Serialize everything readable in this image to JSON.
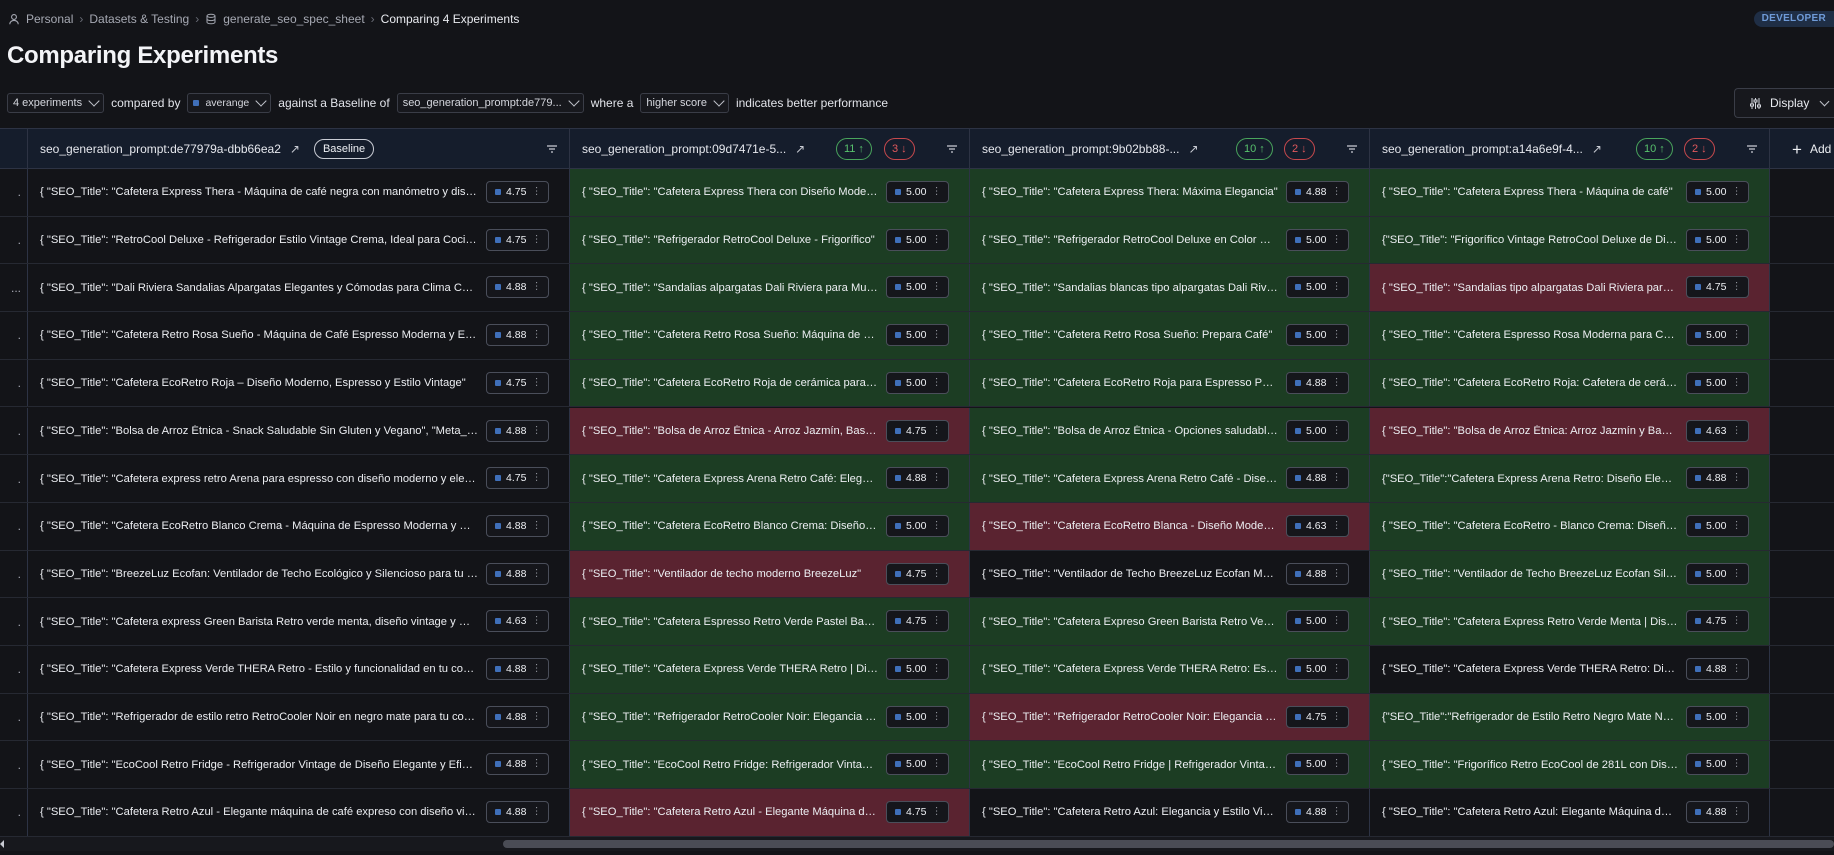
{
  "breadcrumb": {
    "items": [
      "Personal",
      "Datasets & Testing",
      "generate_seo_spec_sheet",
      "Comparing 4 Experiments"
    ]
  },
  "badge": "DEVELOPER",
  "title": "Comparing Experiments",
  "filters": {
    "experiments": "4 experiments",
    "compared_by_label": "compared by",
    "metric": "averange",
    "baseline_label": "against a Baseline of",
    "baseline": "seo_generation_prompt:de779...",
    "where_label": "where a",
    "direction": "higher score",
    "indicates_label": "indicates better performance"
  },
  "display_button": "Display",
  "columns": [
    {
      "name": "seo_generation_prompt:de77979a-dbb66ea2",
      "baseline": "Baseline"
    },
    {
      "name": "seo_generation_prompt:09d7471e-5...",
      "up": "11",
      "down": "3"
    },
    {
      "name": "seo_generation_prompt:9b02bb88-...",
      "up": "10",
      "down": "2"
    },
    {
      "name": "seo_generation_prompt:a14a6e9f-4...",
      "up": "10",
      "down": "2"
    }
  ],
  "add_column": "Add",
  "colors": {
    "better": "#1c3d23",
    "worse": "#5a2330",
    "accent": "#3f6fb9"
  },
  "rows": [
    {
      "stub": ".",
      "cells": [
        {
          "text": "{ \"SEO_Title\": \"Cafetera Express Thera - Máquina de café negra con manómetro y diseño retro\"",
          "score": "4.75",
          "status": ""
        },
        {
          "text": "{ \"SEO_Title\": \"Cafetera Express Thera con Diseño Moderno\"",
          "score": "5.00",
          "status": "g"
        },
        {
          "text": "{ \"SEO_Title\": \"Cafetera Express Thera: Máxima Elegancia\"",
          "score": "4.88",
          "status": "g"
        },
        {
          "text": "{ \"SEO_Title\": \"Cafetera Express Thera - Máquina de café\"",
          "score": "5.00",
          "status": "g"
        }
      ]
    },
    {
      "stub": ".",
      "cells": [
        {
          "text": "{ \"SEO_Title\": \"RetroCool Deluxe - Refrigerador Estilo Vintage Crema, Ideal para Cocinas\"",
          "score": "4.75",
          "status": ""
        },
        {
          "text": "{ \"SEO_Title\": \"Refrigerador RetroCool Deluxe - Frigorífico\"",
          "score": "5.00",
          "status": "g"
        },
        {
          "text": "{ \"SEO_Title\": \"Refrigerador RetroCool Deluxe en Color Crema\"",
          "score": "5.00",
          "status": "g"
        },
        {
          "text": "{\"SEO_Title\": \"Frigorífico Vintage RetroCool Deluxe de Diseño\"",
          "score": "5.00",
          "status": "g"
        }
      ]
    },
    {
      "stub": "...",
      "cells": [
        {
          "text": "{ \"SEO_Title\": \"Dali Riviera Sandalias Alpargatas Elegantes y Cómodas para Clima Cálido\"",
          "score": "4.88",
          "status": ""
        },
        {
          "text": "{ \"SEO_Title\": \"Sandalias alpargatas Dali Riviera para Mujer\"",
          "score": "5.00",
          "status": "g"
        },
        {
          "text": "{ \"SEO_Title\": \"Sandalias blancas tipo alpargatas Dali Riviera\"",
          "score": "5.00",
          "status": "g"
        },
        {
          "text": "{ \"SEO_Title\": \"Sandalias tipo alpargatas Dali Riviera para Mujer\"",
          "score": "4.75",
          "status": "r"
        }
      ]
    },
    {
      "stub": ".",
      "cells": [
        {
          "text": "{ \"SEO_Title\": \"Cafetera Retro Rosa Sueño - Máquina de Café Espresso Moderna y Elegante\"",
          "score": "4.88",
          "status": ""
        },
        {
          "text": "{ \"SEO_Title\": \"Cafetera Retro Rosa Sueño: Máquina de Café\"",
          "score": "5.00",
          "status": "g"
        },
        {
          "text": "{ \"SEO_Title\": \"Cafetera Retro Rosa Sueño: Prepara Café\"",
          "score": "5.00",
          "status": "g"
        },
        {
          "text": "{ \"SEO_Title\": \"Cafetera Espresso Rosa Moderna para Casa\"",
          "score": "5.00",
          "status": "g"
        }
      ]
    },
    {
      "stub": ".",
      "cells": [
        {
          "text": "{ \"SEO_Title\": \"Cafetera EcoRetro Roja – Diseño Moderno, Espresso y Estilo Vintage\"",
          "score": "4.75",
          "status": ""
        },
        {
          "text": "{ \"SEO_Title\": \"Cafetera EcoRetro Roja de cerámica para Espresso\"",
          "score": "5.00",
          "status": "g"
        },
        {
          "text": "{ \"SEO_Title\": \"Cafetera EcoRetro Roja para Espresso Perfecto\"",
          "score": "4.88",
          "status": "g"
        },
        {
          "text": "{ \"SEO_Title\": \"Cafetera EcoRetro Roja: Cafetera de cerámica\"",
          "score": "5.00",
          "status": "g"
        }
      ]
    },
    {
      "stub": ".",
      "cells": [
        {
          "text": "{ \"SEO_Title\": \"Bolsa de Arroz Étnica - Snack Saludable Sin Gluten y Vegano\", \"Meta_Description\"",
          "score": "4.88",
          "status": ""
        },
        {
          "text": "{ \"SEO_Title\": \"Bolsa de Arroz Étnica - Arroz Jazmín, Basmati\"",
          "score": "4.75",
          "status": "r"
        },
        {
          "text": "{ \"SEO_Title\": \"Bolsa de Arroz Étnica - Opciones saludables\"",
          "score": "5.00",
          "status": "g"
        },
        {
          "text": "{ \"SEO_Title\": \"Bolsa de Arroz Étnica: Arroz Jazmín y Basmati\"",
          "score": "4.63",
          "status": "r"
        }
      ]
    },
    {
      "stub": ".",
      "cells": [
        {
          "text": "{ \"SEO_Title\": \"Cafetera express retro Arena para espresso con diseño moderno y elegante\"",
          "score": "4.75",
          "status": ""
        },
        {
          "text": "{ \"SEO_Title\": \"Cafetera Express Arena Retro Café: Elegancia\"",
          "score": "4.88",
          "status": "g"
        },
        {
          "text": "{ \"SEO_Title\": \"Cafetera Express Arena Retro Café - Diseño\"",
          "score": "4.88",
          "status": "g"
        },
        {
          "text": "{\"SEO_Title\":\"Cafetera Express Arena Retro: Diseño Elegante\"",
          "score": "4.88",
          "status": "g"
        }
      ]
    },
    {
      "stub": ".",
      "cells": [
        {
          "text": "{ \"SEO_Title\": \"Cafetera EcoRetro Blanco Crema - Máquina de Espresso Moderna y Sostenible\"",
          "score": "4.88",
          "status": ""
        },
        {
          "text": "{ \"SEO_Title\": \"Cafetera EcoRetro Blanco Crema: Diseño Moderno\"",
          "score": "5.00",
          "status": "g"
        },
        {
          "text": "{ \"SEO_Title\": \"Cafetera EcoRetro Blanca - Diseño Moderno\"",
          "score": "4.63",
          "status": "r"
        },
        {
          "text": "{ \"SEO_Title\": \"Cafetera EcoRetro - Blanco Crema: Diseño Retro\"",
          "score": "5.00",
          "status": "g"
        }
      ]
    },
    {
      "stub": ".",
      "cells": [
        {
          "text": "{ \"SEO_Title\": \"BreezeLuz Ecofan: Ventilador de Techo Ecológico y Silencioso para tu Hogar\"",
          "score": "4.88",
          "status": ""
        },
        {
          "text": "{ \"SEO_Title\": \"Ventilador de techo moderno BreezeLuz\"",
          "score": "4.75",
          "status": "r"
        },
        {
          "text": "{ \"SEO_Title\": \"Ventilador de Techo BreezeLuz Ecofan Moderno\"",
          "score": "4.88",
          "status": ""
        },
        {
          "text": "{ \"SEO_Title\": \"Ventilador de Techo BreezeLuz Ecofan Silencioso\"",
          "score": "5.00",
          "status": "g"
        }
      ]
    },
    {
      "stub": ".",
      "cells": [
        {
          "text": "{ \"SEO_Title\": \"Cafetera express Green Barista Retro verde menta, diseño vintage y moderno\"",
          "score": "4.63",
          "status": ""
        },
        {
          "text": "{ \"SEO_Title\": \"Cafetera Espresso Retro Verde Pastel Barista\"",
          "score": "4.75",
          "status": "g"
        },
        {
          "text": "{ \"SEO_Title\": \"Cafetera Expreso Green Barista Retro Verde\"",
          "score": "5.00",
          "status": "g"
        },
        {
          "text": "{ \"SEO_Title\": \"Cafetera Express Retro Verde Menta | Diseño\"",
          "score": "4.75",
          "status": "g"
        }
      ]
    },
    {
      "stub": ".",
      "cells": [
        {
          "text": "{ \"SEO_Title\": \"Cafetera Express Verde THERA Retro - Estilo y funcionalidad en tu cocina\"",
          "score": "4.88",
          "status": ""
        },
        {
          "text": "{ \"SEO_Title\": \"Cafetera Express Verde THERA Retro | Diseño\"",
          "score": "5.00",
          "status": "g"
        },
        {
          "text": "{ \"SEO_Title\": \"Cafetera Express Verde THERA Retro: Estilo\"",
          "score": "5.00",
          "status": "g"
        },
        {
          "text": "{ \"SEO_Title\": \"Cafetera Express Verde THERA Retro: Diseño\"",
          "score": "4.88",
          "status": ""
        }
      ]
    },
    {
      "stub": ".",
      "cells": [
        {
          "text": "{ \"SEO_Title\": \"Refrigerador de estilo retro RetroCooler Noir en negro mate para tu cocina\"",
          "score": "4.88",
          "status": ""
        },
        {
          "text": "{ \"SEO_Title\": \"Refrigerador RetroCooler Noir: Elegancia Retro\"",
          "score": "5.00",
          "status": "g"
        },
        {
          "text": "{ \"SEO_Title\": \"Refrigerador RetroCooler Noir: Elegancia Vintage\"",
          "score": "4.75",
          "status": "r"
        },
        {
          "text": "{\"SEO_Title\":\"Refrigerador de Estilo Retro Negro Mate Noir\"",
          "score": "5.00",
          "status": "g"
        }
      ]
    },
    {
      "stub": ".",
      "cells": [
        {
          "text": "{ \"SEO_Title\": \"EcoCool Retro Fridge - Refrigerador Vintage de Diseño Elegante y Eficiente\"",
          "score": "4.88",
          "status": ""
        },
        {
          "text": "{ \"SEO_Title\": \"EcoCool Retro Fridge: Refrigerador Vintage\"",
          "score": "5.00",
          "status": "g"
        },
        {
          "text": "{ \"SEO_Title\": \"EcoCool Retro Fridge | Refrigerador Vintage\"",
          "score": "5.00",
          "status": "g"
        },
        {
          "text": "{ \"SEO_Title\": \"Frigorífico Retro EcoCool de 281L con Diseño\"",
          "score": "5.00",
          "status": "g"
        }
      ]
    },
    {
      "stub": ".",
      "cells": [
        {
          "text": "{ \"SEO_Title\": \"Cafetera Retro Azul - Elegante máquina de café expreso con diseño vintage\"",
          "score": "4.88",
          "status": ""
        },
        {
          "text": "{ \"SEO_Title\": \"Cafetera Retro Azul - Elegante Máquina de Café\"",
          "score": "4.75",
          "status": "r"
        },
        {
          "text": "{ \"SEO_Title\": \"Cafetera Retro Azul: Elegancia y Estilo Vintage\"",
          "score": "4.88",
          "status": ""
        },
        {
          "text": "{ \"SEO_Title\": \"Cafetera Retro Azul: Elegante Máquina de Café\"",
          "score": "4.88",
          "status": ""
        }
      ]
    }
  ]
}
